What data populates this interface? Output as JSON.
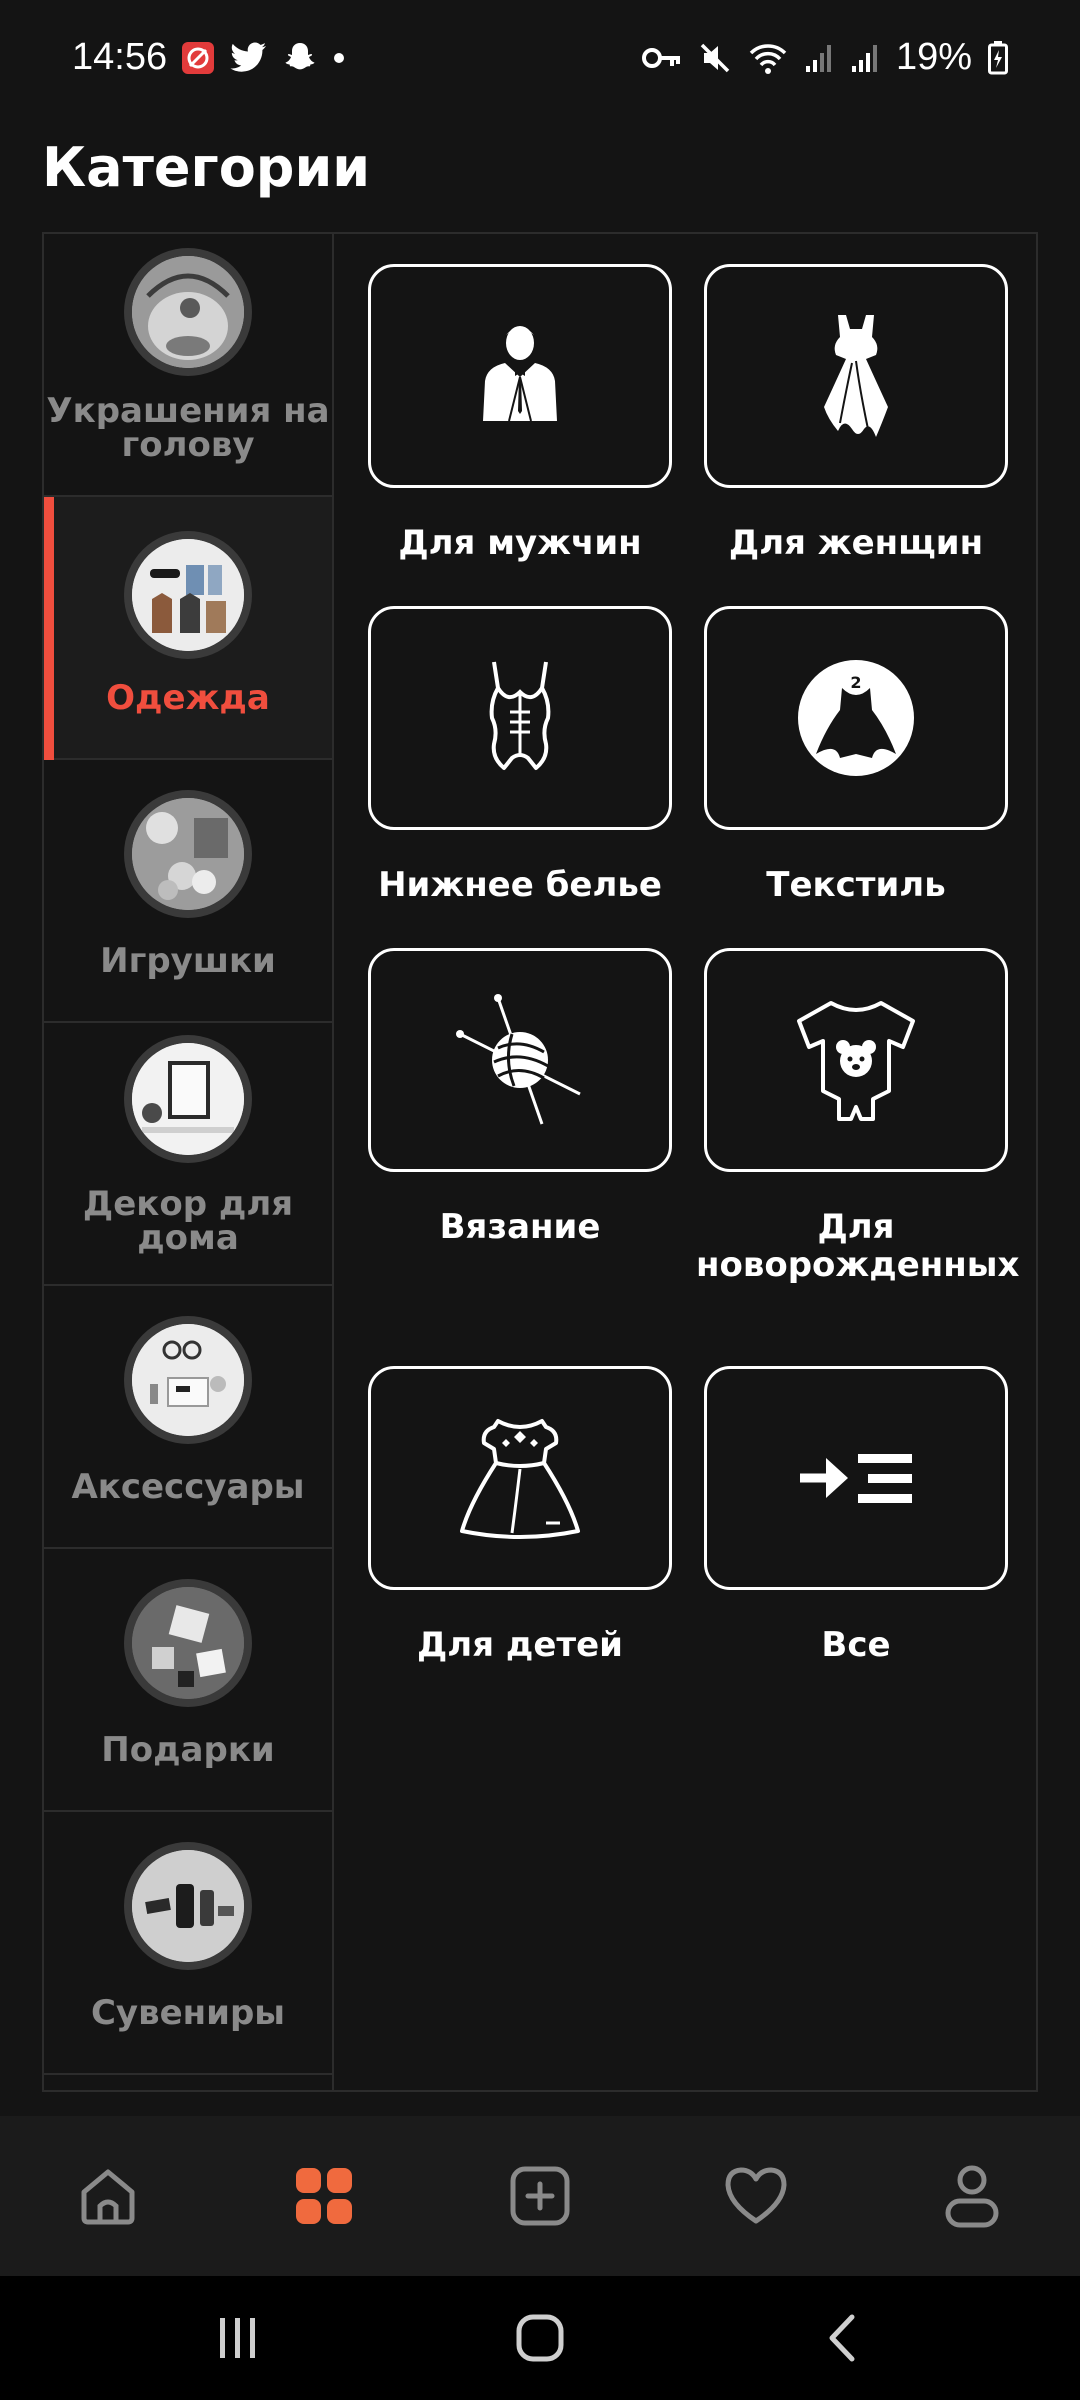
{
  "status": {
    "time": "14:56",
    "battery": "19%"
  },
  "header": {
    "title": "Категории"
  },
  "sidebar": {
    "items": [
      {
        "label": "Украшения на голову",
        "active": false
      },
      {
        "label": "Одежда",
        "active": true
      },
      {
        "label": "Игрушки",
        "active": false
      },
      {
        "label": "Декор для дома",
        "active": false
      },
      {
        "label": "Аксессуары",
        "active": false
      },
      {
        "label": "Подарки",
        "active": false
      },
      {
        "label": "Сувениры",
        "active": false
      }
    ]
  },
  "subcategories": [
    {
      "label": "Для мужчин",
      "icon": "suit-man-icon"
    },
    {
      "label": "Для женщин",
      "icon": "dress-icon"
    },
    {
      "label": "Нижнее белье",
      "icon": "lingerie-icon"
    },
    {
      "label": "Текстиль",
      "icon": "textile-icon"
    },
    {
      "label": "Вязание",
      "icon": "yarn-ball-icon"
    },
    {
      "label": "Для новорожденных",
      "icon": "baby-bodysuit-icon"
    },
    {
      "label": "Для детей",
      "icon": "kids-dress-icon"
    },
    {
      "label": "Все",
      "icon": "show-all-icon"
    }
  ],
  "bottom_nav": {
    "items": [
      "home-icon",
      "categories-icon",
      "add-icon",
      "favorites-icon",
      "profile-icon"
    ],
    "active": "categories-icon"
  },
  "colors": {
    "accent": "#f04e3e",
    "background": "#141414"
  }
}
